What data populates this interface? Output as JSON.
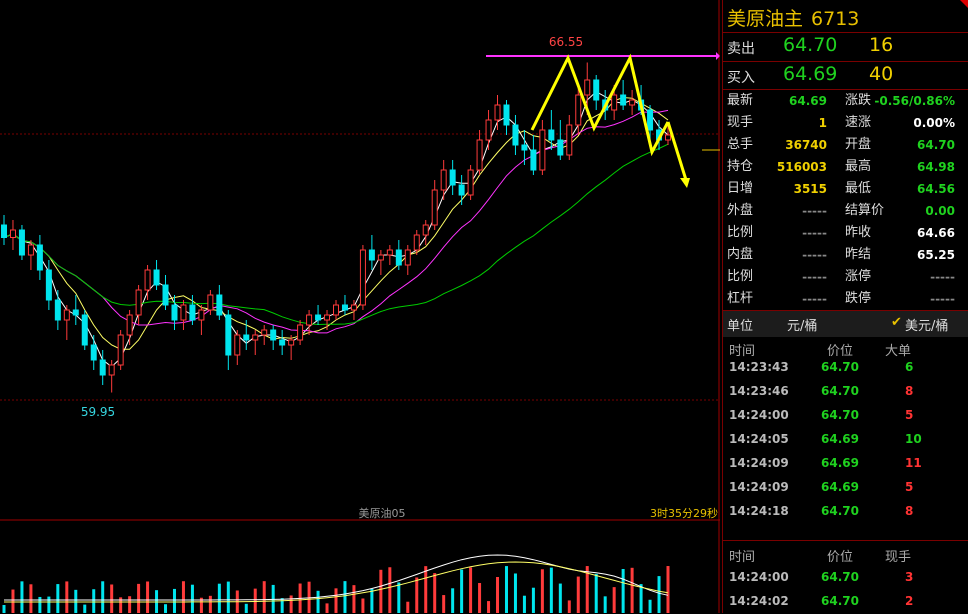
{
  "chart_data": {
    "type": "candlestick",
    "contract_label": "美原油05",
    "countdown": "3时35分29秒",
    "annotations": {
      "high_label": "66.55",
      "low_label": "59.95"
    },
    "price_range": [
      59.2,
      67.2
    ],
    "candles": [
      [
        63.3,
        63.5,
        62.9,
        63.05
      ],
      [
        63.05,
        63.4,
        62.8,
        63.2
      ],
      [
        63.2,
        63.3,
        62.6,
        62.7
      ],
      [
        62.7,
        63.0,
        62.4,
        62.9
      ],
      [
        62.9,
        63.1,
        62.2,
        62.4
      ],
      [
        62.4,
        62.6,
        61.6,
        61.8
      ],
      [
        61.8,
        62.0,
        61.2,
        61.4
      ],
      [
        61.4,
        61.7,
        61.0,
        61.6
      ],
      [
        61.6,
        61.9,
        61.3,
        61.5
      ],
      [
        61.5,
        61.6,
        60.8,
        60.9
      ],
      [
        60.9,
        61.1,
        60.4,
        60.6
      ],
      [
        60.6,
        60.8,
        60.1,
        60.3
      ],
      [
        60.3,
        60.6,
        59.95,
        60.5
      ],
      [
        60.5,
        61.2,
        60.4,
        61.1
      ],
      [
        61.1,
        61.6,
        60.9,
        61.5
      ],
      [
        61.5,
        62.1,
        61.3,
        62.0
      ],
      [
        62.0,
        62.5,
        61.8,
        62.4
      ],
      [
        62.4,
        62.6,
        62.0,
        62.1
      ],
      [
        62.1,
        62.3,
        61.6,
        61.7
      ],
      [
        61.7,
        61.9,
        61.2,
        61.4
      ],
      [
        61.4,
        61.8,
        61.2,
        61.7
      ],
      [
        61.7,
        61.9,
        61.3,
        61.4
      ],
      [
        61.4,
        61.7,
        61.1,
        61.6
      ],
      [
        61.6,
        62.0,
        61.5,
        61.9
      ],
      [
        61.9,
        62.1,
        61.4,
        61.5
      ],
      [
        61.5,
        61.6,
        60.4,
        60.7
      ],
      [
        60.7,
        61.2,
        60.5,
        61.1
      ],
      [
        61.1,
        61.4,
        60.8,
        61.0
      ],
      [
        61.0,
        61.2,
        60.7,
        61.1
      ],
      [
        61.1,
        61.3,
        60.9,
        61.2
      ],
      [
        61.2,
        61.3,
        60.8,
        61.0
      ],
      [
        61.0,
        61.2,
        60.7,
        60.9
      ],
      [
        60.9,
        61.1,
        60.6,
        61.0
      ],
      [
        61.0,
        61.4,
        60.9,
        61.3
      ],
      [
        61.3,
        61.6,
        61.1,
        61.5
      ],
      [
        61.5,
        61.7,
        61.3,
        61.4
      ],
      [
        61.4,
        61.6,
        61.2,
        61.5
      ],
      [
        61.5,
        61.8,
        61.4,
        61.7
      ],
      [
        61.7,
        61.9,
        61.5,
        61.6
      ],
      [
        61.6,
        61.8,
        61.4,
        61.7
      ],
      [
        61.7,
        62.9,
        61.6,
        62.8
      ],
      [
        62.8,
        63.1,
        62.4,
        62.6
      ],
      [
        62.6,
        62.8,
        62.3,
        62.7
      ],
      [
        62.7,
        62.9,
        62.5,
        62.8
      ],
      [
        62.8,
        63.0,
        62.4,
        62.5
      ],
      [
        62.5,
        62.9,
        62.3,
        62.8
      ],
      [
        62.8,
        63.2,
        62.7,
        63.1
      ],
      [
        63.1,
        63.4,
        62.9,
        63.3
      ],
      [
        63.3,
        64.2,
        63.2,
        64.0
      ],
      [
        64.0,
        64.6,
        63.8,
        64.4
      ],
      [
        64.4,
        64.6,
        63.9,
        64.1
      ],
      [
        64.1,
        64.3,
        63.7,
        63.9
      ],
      [
        63.9,
        64.5,
        63.8,
        64.4
      ],
      [
        64.4,
        65.2,
        64.3,
        65.0
      ],
      [
        65.0,
        65.6,
        64.8,
        65.4
      ],
      [
        65.4,
        65.9,
        65.2,
        65.7
      ],
      [
        65.7,
        65.8,
        65.1,
        65.3
      ],
      [
        65.3,
        65.5,
        64.7,
        64.9
      ],
      [
        64.9,
        65.2,
        64.5,
        64.8
      ],
      [
        64.8,
        65.1,
        64.3,
        64.4
      ],
      [
        64.4,
        65.4,
        64.3,
        65.2
      ],
      [
        65.2,
        65.6,
        64.8,
        65.0
      ],
      [
        65.0,
        65.4,
        64.6,
        64.7
      ],
      [
        64.7,
        65.5,
        64.6,
        65.3
      ],
      [
        65.3,
        66.1,
        65.1,
        65.9
      ],
      [
        65.9,
        66.55,
        65.5,
        66.2
      ],
      [
        66.2,
        66.3,
        65.6,
        65.8
      ],
      [
        65.8,
        66.0,
        65.4,
        65.6
      ],
      [
        65.6,
        66.1,
        65.4,
        65.9
      ],
      [
        65.9,
        66.2,
        65.6,
        65.7
      ],
      [
        65.7,
        66.0,
        65.5,
        65.8
      ],
      [
        65.8,
        66.1,
        65.5,
        65.6
      ],
      [
        65.6,
        65.7,
        65.0,
        65.2
      ],
      [
        65.2,
        65.4,
        64.8,
        65.0
      ],
      [
        65.0,
        65.3,
        64.9,
        65.1
      ]
    ],
    "moving_averages": [
      {
        "name": "MA5",
        "color": "#ffffff"
      },
      {
        "name": "MA10",
        "color": "#ffff66"
      },
      {
        "name": "MA20",
        "color": "#ff33ff"
      },
      {
        "name": "MA60",
        "color": "#00cc00"
      }
    ]
  },
  "panel": {
    "title": "美原油主",
    "code": "6713",
    "ask": {
      "label": "卖出",
      "price": "64.70",
      "volume": "16"
    },
    "bid": {
      "label": "买入",
      "price": "64.69",
      "volume": "40"
    },
    "stats_left": [
      {
        "k": "最新",
        "v": "64.69",
        "c": "green"
      },
      {
        "k": "现手",
        "v": "1",
        "c": "yellow"
      },
      {
        "k": "总手",
        "v": "36740",
        "c": "yellow"
      },
      {
        "k": "持仓",
        "v": "516003",
        "c": "yellow"
      },
      {
        "k": "日增",
        "v": "3515",
        "c": "yellow"
      },
      {
        "k": "外盘",
        "v": "-----",
        "c": "grey"
      },
      {
        "k": "比例",
        "v": "-----",
        "c": "grey"
      },
      {
        "k": "内盘",
        "v": "-----",
        "c": "grey"
      },
      {
        "k": "比例",
        "v": "-----",
        "c": "grey"
      },
      {
        "k": "杠杆",
        "v": "-----",
        "c": "grey"
      }
    ],
    "stats_right": [
      {
        "k": "涨跌",
        "v": "-0.56/0.86%",
        "c": "green"
      },
      {
        "k": "速涨",
        "v": "0.00%",
        "c": "white"
      },
      {
        "k": "开盘",
        "v": "64.70",
        "c": "green"
      },
      {
        "k": "最高",
        "v": "64.98",
        "c": "green"
      },
      {
        "k": "最低",
        "v": "64.56",
        "c": "green"
      },
      {
        "k": "结算价",
        "v": "0.00",
        "c": "green"
      },
      {
        "k": "昨收",
        "v": "64.66",
        "c": "white"
      },
      {
        "k": "昨结",
        "v": "65.25",
        "c": "white"
      },
      {
        "k": "涨停",
        "v": "-----",
        "c": "grey"
      },
      {
        "k": "跌停",
        "v": "-----",
        "c": "grey"
      }
    ],
    "unit_label": "单位",
    "unit_value": "元/桶",
    "unit_option": "美元/桶",
    "trades_header": {
      "time": "时间",
      "price": "价位",
      "size": "大单"
    },
    "trades": [
      {
        "time": "14:23:43",
        "price": "64.70",
        "size": "6",
        "c": "green"
      },
      {
        "time": "14:23:46",
        "price": "64.70",
        "size": "8",
        "c": "red"
      },
      {
        "time": "14:24:00",
        "price": "64.70",
        "size": "5",
        "c": "red"
      },
      {
        "time": "14:24:05",
        "price": "64.69",
        "size": "10",
        "c": "green"
      },
      {
        "time": "14:24:09",
        "price": "64.69",
        "size": "11",
        "c": "red"
      },
      {
        "time": "14:24:09",
        "price": "64.69",
        "size": "5",
        "c": "red"
      },
      {
        "time": "14:24:18",
        "price": "64.70",
        "size": "8",
        "c": "red"
      }
    ],
    "ticks_header": {
      "time": "时间",
      "price": "价位",
      "size": "现手"
    },
    "ticks": [
      {
        "time": "14:24:00",
        "price": "64.70",
        "size": "3",
        "c": "red"
      },
      {
        "time": "14:24:02",
        "price": "64.70",
        "size": "2",
        "c": "red"
      }
    ]
  }
}
